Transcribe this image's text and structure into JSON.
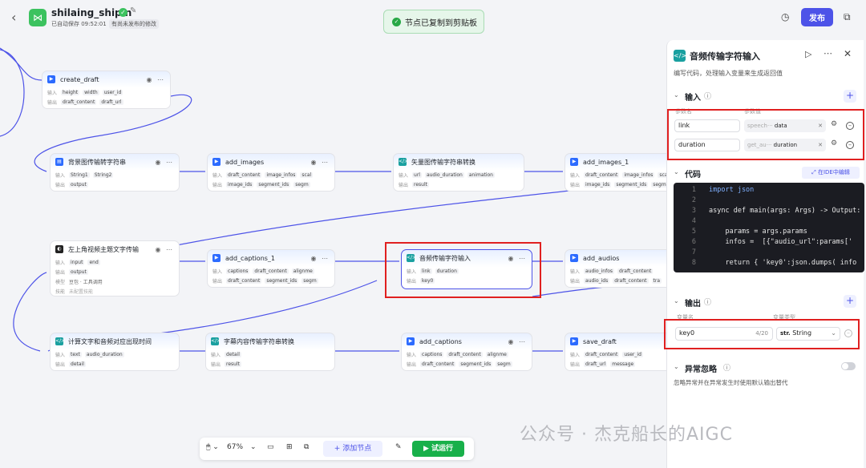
{
  "header": {
    "app_name": "shilaing_shipin",
    "autosave": "已自动保存 09:52:01",
    "unpublished": "有尚未发布的修改",
    "publish_label": "发布",
    "toast": "节点已复制到剪贴板"
  },
  "labels": {
    "in": "输入",
    "out": "输出",
    "model": "模型",
    "skill": "技能"
  },
  "nodes": {
    "create_draft": {
      "title": "create_draft",
      "in": [
        "height",
        "width",
        "user_id"
      ],
      "out": [
        "draft_content",
        "draft_url"
      ]
    },
    "bg": {
      "title": "背景图传输转字符串",
      "in": [
        "String1",
        "String2"
      ],
      "out": [
        "output"
      ]
    },
    "add_images": {
      "title": "add_images",
      "in": [
        "draft_content",
        "image_infos",
        "scal"
      ],
      "out": [
        "image_ids",
        "segment_ids",
        "segm"
      ]
    },
    "vector": {
      "title": "矢量图传输字符串转换",
      "in": [
        "url",
        "audio_duration",
        "animation"
      ],
      "out": [
        "result"
      ]
    },
    "add_images_1": {
      "title": "add_images_1",
      "in": [
        "draft_content",
        "image_infos",
        "scal"
      ],
      "out": [
        "image_ids",
        "segment_ids",
        "segm"
      ]
    },
    "subtitle": {
      "title": "左上角视频主题文字传输",
      "in": [
        "input",
        "end"
      ],
      "out": [
        "output"
      ],
      "model": "豆包 · 工具调用",
      "skill": "未配置技能"
    },
    "add_captions_1": {
      "title": "add_captions_1",
      "in": [
        "captions",
        "draft_content",
        "alignme"
      ],
      "out": [
        "draft_content",
        "segment_ids",
        "segm"
      ]
    },
    "audio_input": {
      "title": "音频传输字符输入",
      "in": [
        "link",
        "duration"
      ],
      "out": [
        "key0"
      ]
    },
    "add_audios": {
      "title": "add_audios",
      "in": [
        "audio_infos",
        "draft_content"
      ],
      "out": [
        "audio_ids",
        "draft_content",
        "tra"
      ]
    },
    "calc_time": {
      "title": "计算文字和音频对应出现时间",
      "in": [
        "text",
        "audio_duration"
      ],
      "out": [
        "detail"
      ]
    },
    "caption_conv": {
      "title": "字幕内容传输字符串转换",
      "in": [
        "detail"
      ],
      "out": [
        "result"
      ]
    },
    "add_captions": {
      "title": "add_captions",
      "in": [
        "captions",
        "draft_content",
        "alignme"
      ],
      "out": [
        "draft_content",
        "segment_ids",
        "segm"
      ]
    },
    "save_draft": {
      "title": "save_draft",
      "in": [
        "draft_content",
        "user_id"
      ],
      "out": [
        "draft_url",
        "message"
      ]
    }
  },
  "panel": {
    "title": "音频传输字符输入",
    "desc": "编写代码，处理输入变量来生成返回值",
    "input_section": "输入",
    "col_name": "参数名",
    "col_value": "参数值",
    "params": [
      {
        "name": "link",
        "src": "speech···",
        "val": "data"
      },
      {
        "name": "duration",
        "src": "get_au···",
        "val": "duration"
      }
    ],
    "code_section": "代码",
    "ide_label": "在IDE中编辑",
    "code_lines": [
      "import json",
      "",
      "async def main(args: Args) -> Output:",
      "",
      "    params = args.params",
      "    infos =  [{\"audio_url\":params['",
      "",
      "    return { 'key0':json.dumps( info"
    ],
    "line_numbers": [
      "1",
      "2",
      "3",
      "4",
      "5",
      "6",
      "7",
      "8"
    ],
    "output_section": "输出",
    "out_col_name": "变量名",
    "out_col_type": "变量类型",
    "output_name": "key0",
    "output_count": "4/20",
    "output_type": "String",
    "exception_section": "异常忽略",
    "exception_desc": "忽略异常并在异常发生时使用默认输出替代"
  },
  "toolbar": {
    "zoom": "67%",
    "add_node": "添加节点",
    "run": "试运行"
  },
  "watermark": "公众号 · 杰克船长的AIGC",
  "colors": {
    "accent": "#4d53e8",
    "run": "#18b04a",
    "highlight": "#e02020"
  }
}
